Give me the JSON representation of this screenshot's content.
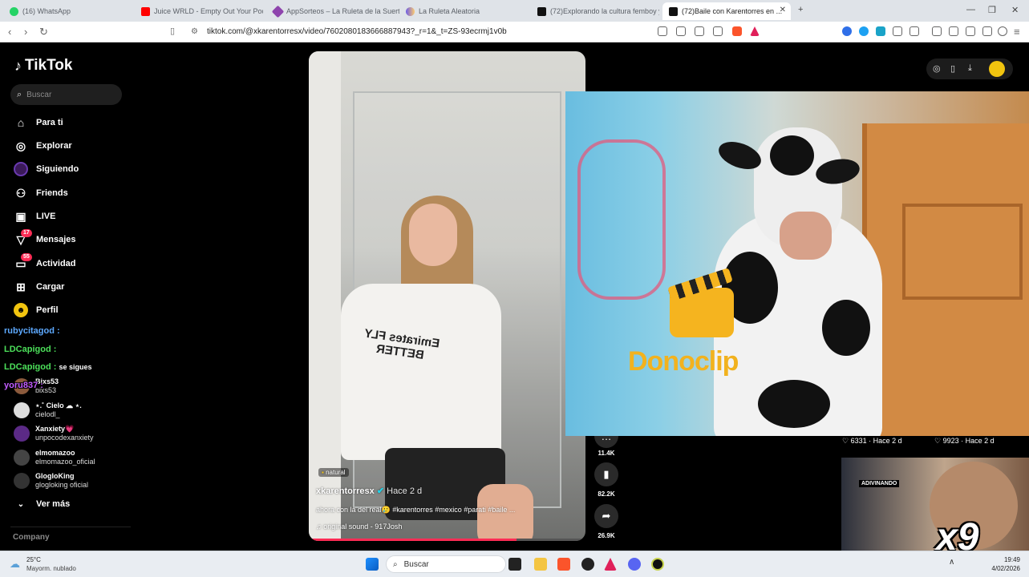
{
  "browser": {
    "tabs": [
      {
        "title": "(16) WhatsApp",
        "color": "#25d366"
      },
      {
        "title": "Juice WRLD - Empty Out Your Pockets",
        "color": "#ff0000"
      },
      {
        "title": "AppSorteos – La Ruleta de la Suerte",
        "color": "#8e44ad"
      },
      {
        "title": "La Ruleta Aleatoria",
        "color": "#6c5ce7"
      },
      {
        "title": "(72)Explorando la cultura femboy y ...",
        "color": "#111111"
      },
      {
        "title": "(72)Baile con Karentorres en ...",
        "color": "#111111"
      }
    ],
    "new_tab": "+",
    "url": "tiktok.com/@xkarentorresx/video/7602080183666887943?_r=1&_t=ZS-93ecrmj1v0b"
  },
  "tiktok": {
    "logo": "TikTok",
    "search_placeholder": "Buscar",
    "nav": [
      {
        "label": "Para ti",
        "icon": "home-icon"
      },
      {
        "label": "Explorar",
        "icon": "compass-icon"
      },
      {
        "label": "Siguiendo",
        "icon": "following-icon"
      },
      {
        "label": "Friends",
        "icon": "friends-icon"
      },
      {
        "label": "LIVE",
        "icon": "live-icon"
      },
      {
        "label": "Mensajes",
        "icon": "messages-icon",
        "badge": "17"
      },
      {
        "label": "Actividad",
        "icon": "activity-icon",
        "badge": "55"
      },
      {
        "label": "Cargar",
        "icon": "upload-icon"
      },
      {
        "label": "Perfil",
        "icon": "profile-icon"
      }
    ],
    "following": [
      {
        "name": "Bixs53",
        "handle": "bixs53"
      },
      {
        "name": "⋆.˚ Cielo ☁ ⋆.",
        "handle": "cielodl_"
      },
      {
        "name": "Xanxiety💗",
        "handle": "unpocodexanxiety"
      },
      {
        "name": "elmomazoo",
        "handle": "elmomazoo_oficial"
      },
      {
        "name": "GlogloKing",
        "handle": "glogloking oficial"
      }
    ],
    "see_more": "Ver más",
    "company": "Company",
    "chat_overlay": [
      {
        "user": "rubycitagod :",
        "color": "#5da9ff"
      },
      {
        "user": "LDCapigod :",
        "color": "#4ce05a"
      },
      {
        "user": "LDCapigod :",
        "color": "#4ce05a",
        "text": "se sigues"
      },
      {
        "user": "yoru837 :",
        "color": "#c35dff"
      }
    ],
    "video": {
      "tag": "natural",
      "author": "xkarentorresx",
      "time": "Hace 2 d",
      "caption": "ahora con la del real🥲 #karentorres #mexico #parati #baile ...",
      "sound": "original sound - 917Josh",
      "shirt_text": "Emirates FLY BETTER"
    },
    "actions": [
      {
        "icon": "comment-icon",
        "count": "11.4K"
      },
      {
        "icon": "bookmark-icon",
        "count": "82.2K"
      },
      {
        "icon": "share-icon",
        "count": "26.9K"
      }
    ],
    "related": [
      {
        "likes": "6331",
        "time": "Hace 2 d"
      },
      {
        "likes": "9923",
        "time": "Hace 2 d"
      }
    ],
    "thumb_label": "ADIVINANDO",
    "overlay_brand": "Donoclip",
    "multiplier": "x9"
  },
  "taskbar": {
    "temp": "25°C",
    "weather": "Mayorm. nublado",
    "search": "Buscar",
    "time": "19:49",
    "date": "4/02/2026"
  }
}
